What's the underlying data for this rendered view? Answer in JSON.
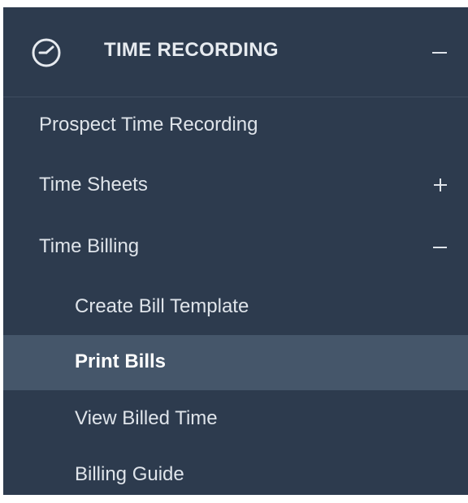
{
  "header": {
    "title": "TIME RECORDING",
    "icon": "clock-icon",
    "toggle_icon": "minus-icon"
  },
  "menu": {
    "items": [
      {
        "label": "Prospect Time Recording",
        "level": 1
      },
      {
        "label": "Time Sheets",
        "level": 1,
        "toggle_icon": "plus-icon",
        "expanded": false
      },
      {
        "label": "Time Billing",
        "level": 1,
        "toggle_icon": "minus-icon",
        "expanded": true
      },
      {
        "label": "Create Bill Template",
        "level": 2
      },
      {
        "label": "Print Bills",
        "level": 2,
        "active": true
      },
      {
        "label": "View Billed Time",
        "level": 2
      },
      {
        "label": "Billing Guide",
        "level": 2
      }
    ]
  },
  "colors": {
    "sidebar_bg": "#2d3b4e",
    "active_bg": "#45566a",
    "text": "#dfe4ea"
  }
}
